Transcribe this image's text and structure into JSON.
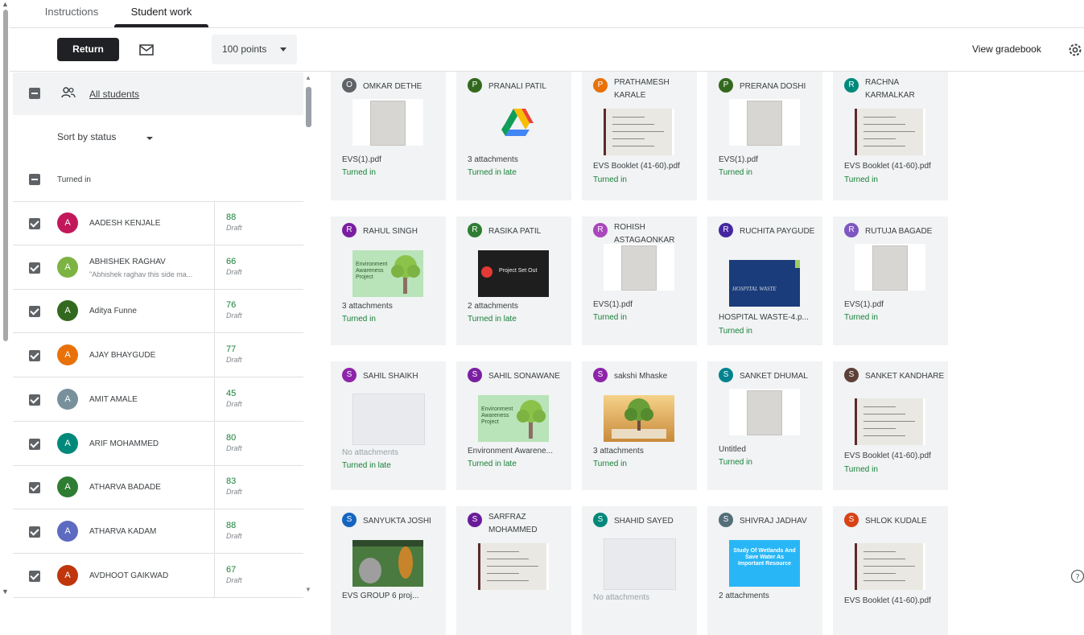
{
  "tabs": [
    {
      "label": "Instructions",
      "active": false
    },
    {
      "label": "Student work",
      "active": true
    }
  ],
  "toolbar": {
    "return_label": "Return",
    "points_value": "100 points",
    "gradebook_label": "View gradebook"
  },
  "left_panel": {
    "all_students_label": "All students",
    "sort_label": "Sort by status",
    "section_label": "Turned in",
    "students": [
      {
        "initial": "A",
        "name": "AADESH KENJALE",
        "subtitle": "",
        "grade": "88",
        "status": "Draft",
        "color": "#c2185b"
      },
      {
        "initial": "A",
        "name": "ABHISHEK RAGHAV",
        "subtitle": "\"Abhishek raghav this side ma...",
        "grade": "66",
        "status": "Draft",
        "color": "#7cb342"
      },
      {
        "initial": "A",
        "name": "Aditya Funne",
        "subtitle": "",
        "grade": "76",
        "status": "Draft",
        "color": "#33691e"
      },
      {
        "initial": "A",
        "name": "AJAY BHAYGUDE",
        "subtitle": "",
        "grade": "77",
        "status": "Draft",
        "color": "#e8710a"
      },
      {
        "initial": "A",
        "name": "AMIT AMALE",
        "subtitle": "",
        "grade": "45",
        "status": "Draft",
        "color": "#78909c"
      },
      {
        "initial": "A",
        "name": "ARIF MOHAMMED",
        "subtitle": "",
        "grade": "80",
        "status": "Draft",
        "color": "#00897b"
      },
      {
        "initial": "A",
        "name": "ATHARVA BADADE",
        "subtitle": "",
        "grade": "83",
        "status": "Draft",
        "color": "#2e7d32"
      },
      {
        "initial": "A",
        "name": "ATHARVA KADAM",
        "subtitle": "",
        "grade": "88",
        "status": "Draft",
        "color": "#5c6bc0"
      },
      {
        "initial": "A",
        "name": "AVDHOOT GAIKWAD",
        "subtitle": "",
        "grade": "67",
        "status": "Draft",
        "color": "#bf360c"
      }
    ]
  },
  "cards": [
    {
      "initial": "O",
      "name": "OMKAR DETHE",
      "file": "EVS(1).pdf",
      "status": "Turned in",
      "color": "#5f6368",
      "thumb": "paper"
    },
    {
      "initial": "P",
      "name": "PRANALI PATIL",
      "file": "3 attachments",
      "status": "Turned in late",
      "color": "#33691e",
      "thumb": "drive"
    },
    {
      "initial": "P",
      "name": "PRATHAMESH KARALE",
      "file": "EVS Booklet (41-60).pdf",
      "status": "Turned in",
      "color": "#e8710a",
      "thumb": "notebook"
    },
    {
      "initial": "P",
      "name": "PRERANA DOSHI",
      "file": "EVS(1).pdf",
      "status": "Turned in",
      "color": "#33691e",
      "thumb": "paper"
    },
    {
      "initial": "R",
      "name": "RACHNA KARMALKAR",
      "file": "EVS Booklet (41-60).pdf",
      "status": "Turned in",
      "color": "#00897b",
      "thumb": "notebook"
    },
    {
      "initial": "R",
      "name": "RAHUL SINGH",
      "file": "3 attachments",
      "status": "Turned in",
      "color": "#7b1fa2",
      "thumb": "tree"
    },
    {
      "initial": "R",
      "name": "RASIKA PATIL",
      "file": "2 attachments",
      "status": "Turned in late",
      "color": "#2e7d32",
      "thumb": "video"
    },
    {
      "initial": "R",
      "name": "ROHISH ASTAGAONKAR",
      "file": "EVS(1).pdf",
      "status": "Turned in",
      "color": "#ab47bc",
      "thumb": "paper"
    },
    {
      "initial": "R",
      "name": "RUCHITA PAYGUDE",
      "file": "HOSPITAL WASTE-4.p...",
      "status": "Turned in",
      "color": "#4527a0",
      "thumb": "hospital"
    },
    {
      "initial": "R",
      "name": "RUTUJA BAGADE",
      "file": "EVS(1).pdf",
      "status": "Turned in",
      "color": "#7e57c2",
      "thumb": "paper"
    },
    {
      "initial": "S",
      "name": "SAHIL SHAIKH",
      "file": "No attachments",
      "status": "Turned in late",
      "color": "#8e24aa",
      "thumb": "empty"
    },
    {
      "initial": "S",
      "name": "SAHIL SONAWANE",
      "file": "Environment Awarene...",
      "status": "Turned in late",
      "color": "#7b1fa2",
      "thumb": "tree"
    },
    {
      "initial": "S",
      "name": "sakshi Mhaske",
      "file": "3 attachments",
      "status": "Turned in",
      "color": "#8e24aa",
      "thumb": "book"
    },
    {
      "initial": "S",
      "name": "SANKET DHUMAL",
      "file": "Untitled",
      "status": "Turned in",
      "color": "#00838f",
      "thumb": "paper"
    },
    {
      "initial": "S",
      "name": "SANKET KANDHARE",
      "file": "EVS Booklet (41-60).pdf",
      "status": "Turned in",
      "color": "#5d4037",
      "thumb": "notebook"
    },
    {
      "initial": "S",
      "name": "SANYUKTA JOSHI",
      "file": "EVS GROUP 6 proj...",
      "status": "",
      "color": "#1565c0",
      "thumb": "wildlife"
    },
    {
      "initial": "S",
      "name": "SARFRAZ MOHAMMED",
      "file": "",
      "status": "",
      "color": "#6a1b9a",
      "thumb": "notebook"
    },
    {
      "initial": "S",
      "name": "SHAHID SAYED",
      "file": "No attachments",
      "status": "",
      "color": "#00897b",
      "thumb": "empty"
    },
    {
      "initial": "S",
      "name": "SHIVRAJ JADHAV",
      "file": "2 attachments",
      "status": "",
      "color": "#546e7a",
      "thumb": "wetlands"
    },
    {
      "initial": "S",
      "name": "SHLOK KUDALE",
      "file": "EVS Booklet (41-60).pdf",
      "status": "",
      "color": "#d84315",
      "thumb": "notebook"
    }
  ],
  "thumb_text": {
    "tree": "Environment Awareness Project",
    "video": "Project Set Out",
    "hospital": "HOSPITAL WASTE",
    "wetlands": "Study Of Wetlands And Save Water As Important Resource"
  }
}
